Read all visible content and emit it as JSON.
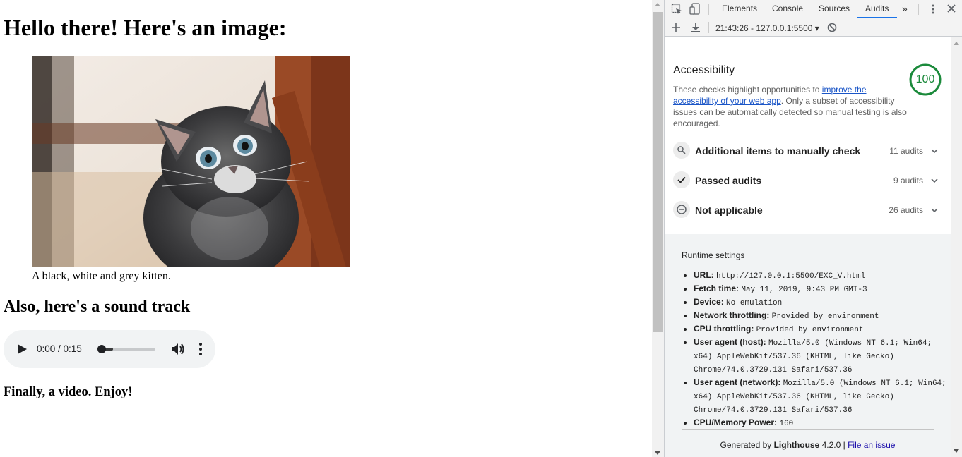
{
  "page": {
    "heading": "Hello there! Here's an image:",
    "image_caption": "A black, white and grey kitten.",
    "sound_heading": "Also, here's a sound track",
    "audio": {
      "time": "0:00 / 0:15",
      "progress": 0.0
    },
    "video_text": "Finally, a video. Enjoy!"
  },
  "devtools": {
    "tabs": [
      {
        "label": "Elements"
      },
      {
        "label": "Console"
      },
      {
        "label": "Sources"
      },
      {
        "label": "Audits",
        "active": true
      }
    ],
    "session": "21:43:26 - 127.0.0.1:5500 ▾",
    "category": {
      "title": "Accessibility",
      "score": "100",
      "desc_before": "These checks highlight opportunities to ",
      "desc_link": "improve the accessibility of your web app",
      "desc_after": ". Only a subset of accessibility issues can be automatically detected so manual testing is also encouraged."
    },
    "groups": [
      {
        "icon": "search-icon",
        "label": "Additional items to manually check",
        "count": "11 audits"
      },
      {
        "icon": "checkmark-icon",
        "label": "Passed audits",
        "count": "9 audits"
      },
      {
        "icon": "minus-circle-icon",
        "label": "Not applicable",
        "count": "26 audits"
      }
    ],
    "runtime": {
      "title": "Runtime settings",
      "items": [
        {
          "key": "URL:",
          "value": "http://127.0.0.1:5500/EXC_V.html"
        },
        {
          "key": "Fetch time:",
          "value": "May 11, 2019, 9:43 PM GMT-3"
        },
        {
          "key": "Device:",
          "value": "No emulation"
        },
        {
          "key": "Network throttling:",
          "value": "Provided by environment"
        },
        {
          "key": "CPU throttling:",
          "value": "Provided by environment"
        },
        {
          "key": "User agent (host):",
          "value": "Mozilla/5.0 (Windows NT 6.1; Win64; x64) AppleWebKit/537.36 (KHTML, like Gecko) Chrome/74.0.3729.131 Safari/537.36"
        },
        {
          "key": "User agent (network):",
          "value": "Mozilla/5.0 (Windows NT 6.1; Win64; x64) AppleWebKit/537.36 (KHTML, like Gecko) Chrome/74.0.3729.131 Safari/537.36"
        },
        {
          "key": "CPU/Memory Power:",
          "value": "160"
        }
      ]
    },
    "footer": {
      "prefix": "Generated by ",
      "brand": "Lighthouse",
      "version": " 4.2.0 | ",
      "link": "File an issue"
    }
  },
  "colors": {
    "score_green": "#1b8a3b",
    "tab_accent": "#1a73e8",
    "link_blue": "#1a55c7"
  }
}
